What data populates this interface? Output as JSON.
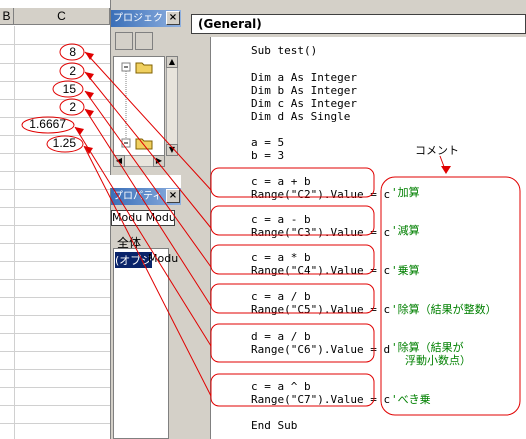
{
  "sheet": {
    "col_b": "B",
    "col_c": "C",
    "cells": [
      "8",
      "2",
      "15",
      "2",
      "1.6667",
      "1.25"
    ]
  },
  "project_panel": {
    "title": "プロジェクト - ",
    "close": "×"
  },
  "properties_panel": {
    "title": "プロパティ - M",
    "combo_value": "Modu Modu",
    "tab_all": "全体",
    "row_name": "(オブジ",
    "row_value": "Modu"
  },
  "code_window": {
    "object_combo": "(General)",
    "lines": [
      "Sub test()",
      "",
      "Dim a As Integer",
      "Dim b As Integer",
      "Dim c As Integer",
      "Dim d As Single",
      "",
      "a = 5",
      "b = 3"
    ],
    "blocks": [
      {
        "code1": "c = a + b",
        "code2": "Range(\"C2\").Value = c",
        "comment": "'加算"
      },
      {
        "code1": "c = a - b",
        "code2": "Range(\"C3\").Value = c",
        "comment": "'減算"
      },
      {
        "code1": "c = a * b",
        "code2": "Range(\"C4\").Value = c",
        "comment": "'乗算"
      },
      {
        "code1": "c = a / b",
        "code2": "Range(\"C5\").Value = c",
        "comment": "'除算（結果が整数）"
      },
      {
        "code1": "d = a / b",
        "code2": "Range(\"C6\").Value = d",
        "comment": "'除算（結果が",
        "comment2": "浮動小数点）"
      },
      {
        "code1": "c = a ^ b",
        "code2": "Range(\"C7\").Value = c",
        "comment": "'べき乗"
      }
    ],
    "end_line": "End Sub",
    "annotation": "コメント"
  },
  "colors": {
    "annotation_red": "#e00000",
    "comment_green": "#008000",
    "titlebar_blue": "#3a6fb8"
  }
}
